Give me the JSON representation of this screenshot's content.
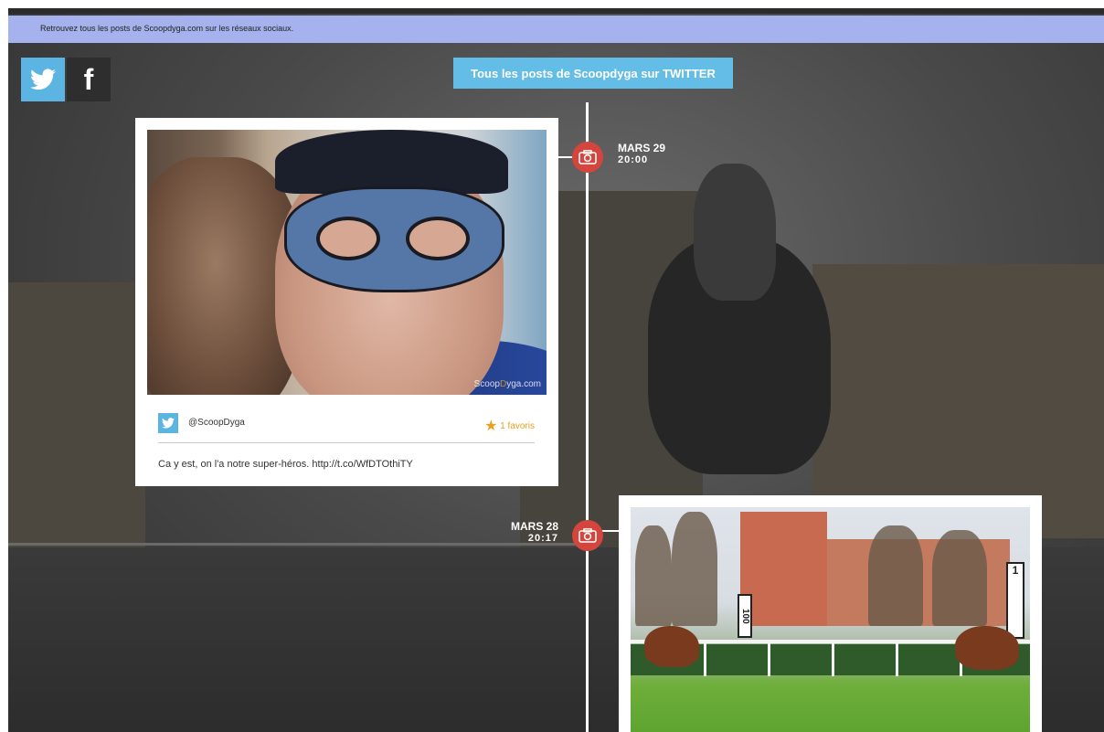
{
  "banner": {
    "text": "Retrouvez tous les posts de Scoopdyga.com sur les réseaux sociaux."
  },
  "social": {
    "twitter_icon": "twitter-icon",
    "facebook_icon": "facebook-icon",
    "facebook_glyph": "f"
  },
  "posts_button": {
    "label": "Tous les posts de Scoopdyga sur TWITTER"
  },
  "timeline": {
    "entries": [
      {
        "date": "MARS 29",
        "time": "20:00",
        "icon": "camera-icon"
      },
      {
        "date": "MARS 28",
        "time": "20:17",
        "icon": "camera-icon"
      }
    ]
  },
  "posts": [
    {
      "handle": "@ScoopDyga",
      "favorites": "1 favoris",
      "text": "Ca y est, on l'a notre super-héros. http://t.co/WfDTOthiTY",
      "watermark_a": "Scoop",
      "watermark_b": "D",
      "watermark_c": "yga.com"
    },
    {
      "sign_a": "100",
      "sign_b": "1"
    }
  ],
  "colors": {
    "accent_blue": "#64bde6",
    "banner": "#a5b2ee",
    "node_red": "#d3453d",
    "fav_orange": "#e8a020"
  }
}
